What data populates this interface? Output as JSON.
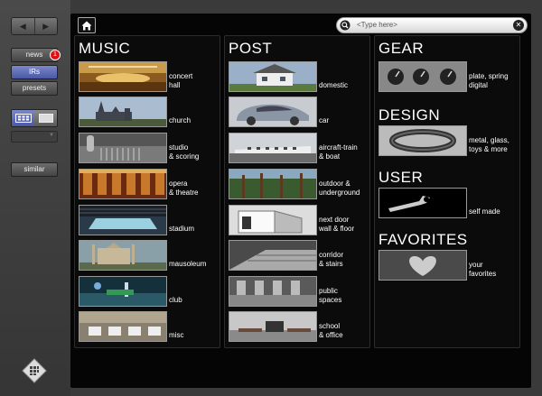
{
  "sidebar": {
    "back_icon": "back-arrow-icon",
    "forward_icon": "forward-arrow-icon",
    "buttons": [
      {
        "label": "news",
        "badge": "1"
      },
      {
        "label": "IRs",
        "active": true
      },
      {
        "label": "presets"
      }
    ],
    "similar_label": "similar"
  },
  "toolbar": {
    "home_icon": "home-icon",
    "search_placeholder": "<Type here>"
  },
  "panels": {
    "music": {
      "title": "MUSIC",
      "items": [
        {
          "label": "concert\nhall"
        },
        {
          "label": "church"
        },
        {
          "label": "studio\n& scoring"
        },
        {
          "label": "opera\n& theatre"
        },
        {
          "label": "stadium"
        },
        {
          "label": "mausoleum"
        },
        {
          "label": "club"
        },
        {
          "label": "misc"
        }
      ]
    },
    "post": {
      "title": "POST",
      "items": [
        {
          "label": "domestic"
        },
        {
          "label": "car"
        },
        {
          "label": "aircraft-train\n& boat"
        },
        {
          "label": "outdoor &\nunderground"
        },
        {
          "label": "next door\nwall & floor"
        },
        {
          "label": "corridor\n& stairs"
        },
        {
          "label": "public\nspaces"
        },
        {
          "label": "school\n& office"
        }
      ]
    },
    "gear": {
      "title": "GEAR",
      "label": "plate, spring\ndigital"
    },
    "design": {
      "title": "DESIGN",
      "label": "metal, glass,\ntoys & more"
    },
    "user": {
      "title": "USER",
      "label": "self made"
    },
    "favorites": {
      "title": "FAVORITES",
      "label": "your\nfavorites"
    }
  },
  "colors": {
    "accent": "#4a58a6",
    "badge": "#dd1111",
    "background": "#050505"
  }
}
